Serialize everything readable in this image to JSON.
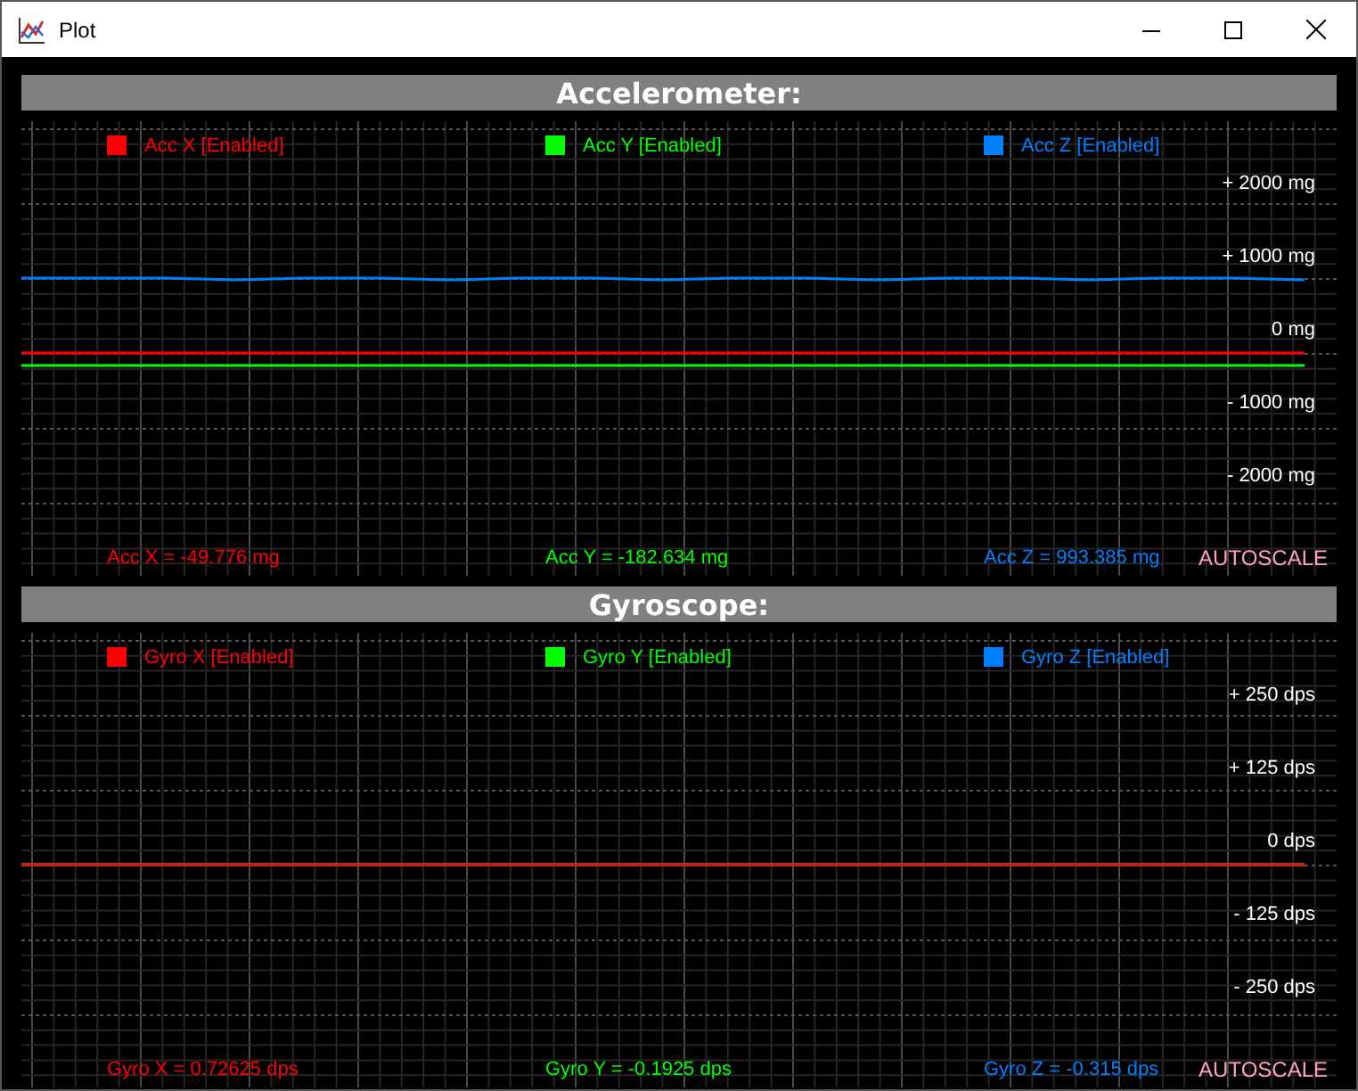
{
  "window": {
    "title": "Plot"
  },
  "panels": [
    {
      "title": "Accelerometer:",
      "legend": [
        {
          "label": "Acc X [Enabled]",
          "color": "#ff0000"
        },
        {
          "label": "Acc Y [Enabled]",
          "color": "#00ff00"
        },
        {
          "label": "Acc Z [Enabled]",
          "color": "#0080ff"
        }
      ],
      "ticks": [
        "+ 2000 mg",
        "+ 1000 mg",
        "0 mg",
        "- 1000 mg",
        "- 2000 mg"
      ],
      "readouts": [
        "Acc X = -49.776 mg",
        "Acc Y = -182.634 mg",
        "Acc Z = 993.385 mg"
      ],
      "autoscale": "AUTOSCALE"
    },
    {
      "title": "Gyroscope:",
      "legend": [
        {
          "label": "Gyro X [Enabled]",
          "color": "#ff0000"
        },
        {
          "label": "Gyro Y [Enabled]",
          "color": "#00ff00"
        },
        {
          "label": "Gyro Z [Enabled]",
          "color": "#0080ff"
        }
      ],
      "ticks": [
        "+ 250 dps",
        "+ 125 dps",
        "0 dps",
        "- 125 dps",
        "- 250 dps"
      ],
      "readouts": [
        "Gyro X = 0.72625 dps",
        "Gyro Y = -0.1925 dps",
        "Gyro Z = -0.315 dps"
      ],
      "autoscale": "AUTOSCALE"
    }
  ]
}
